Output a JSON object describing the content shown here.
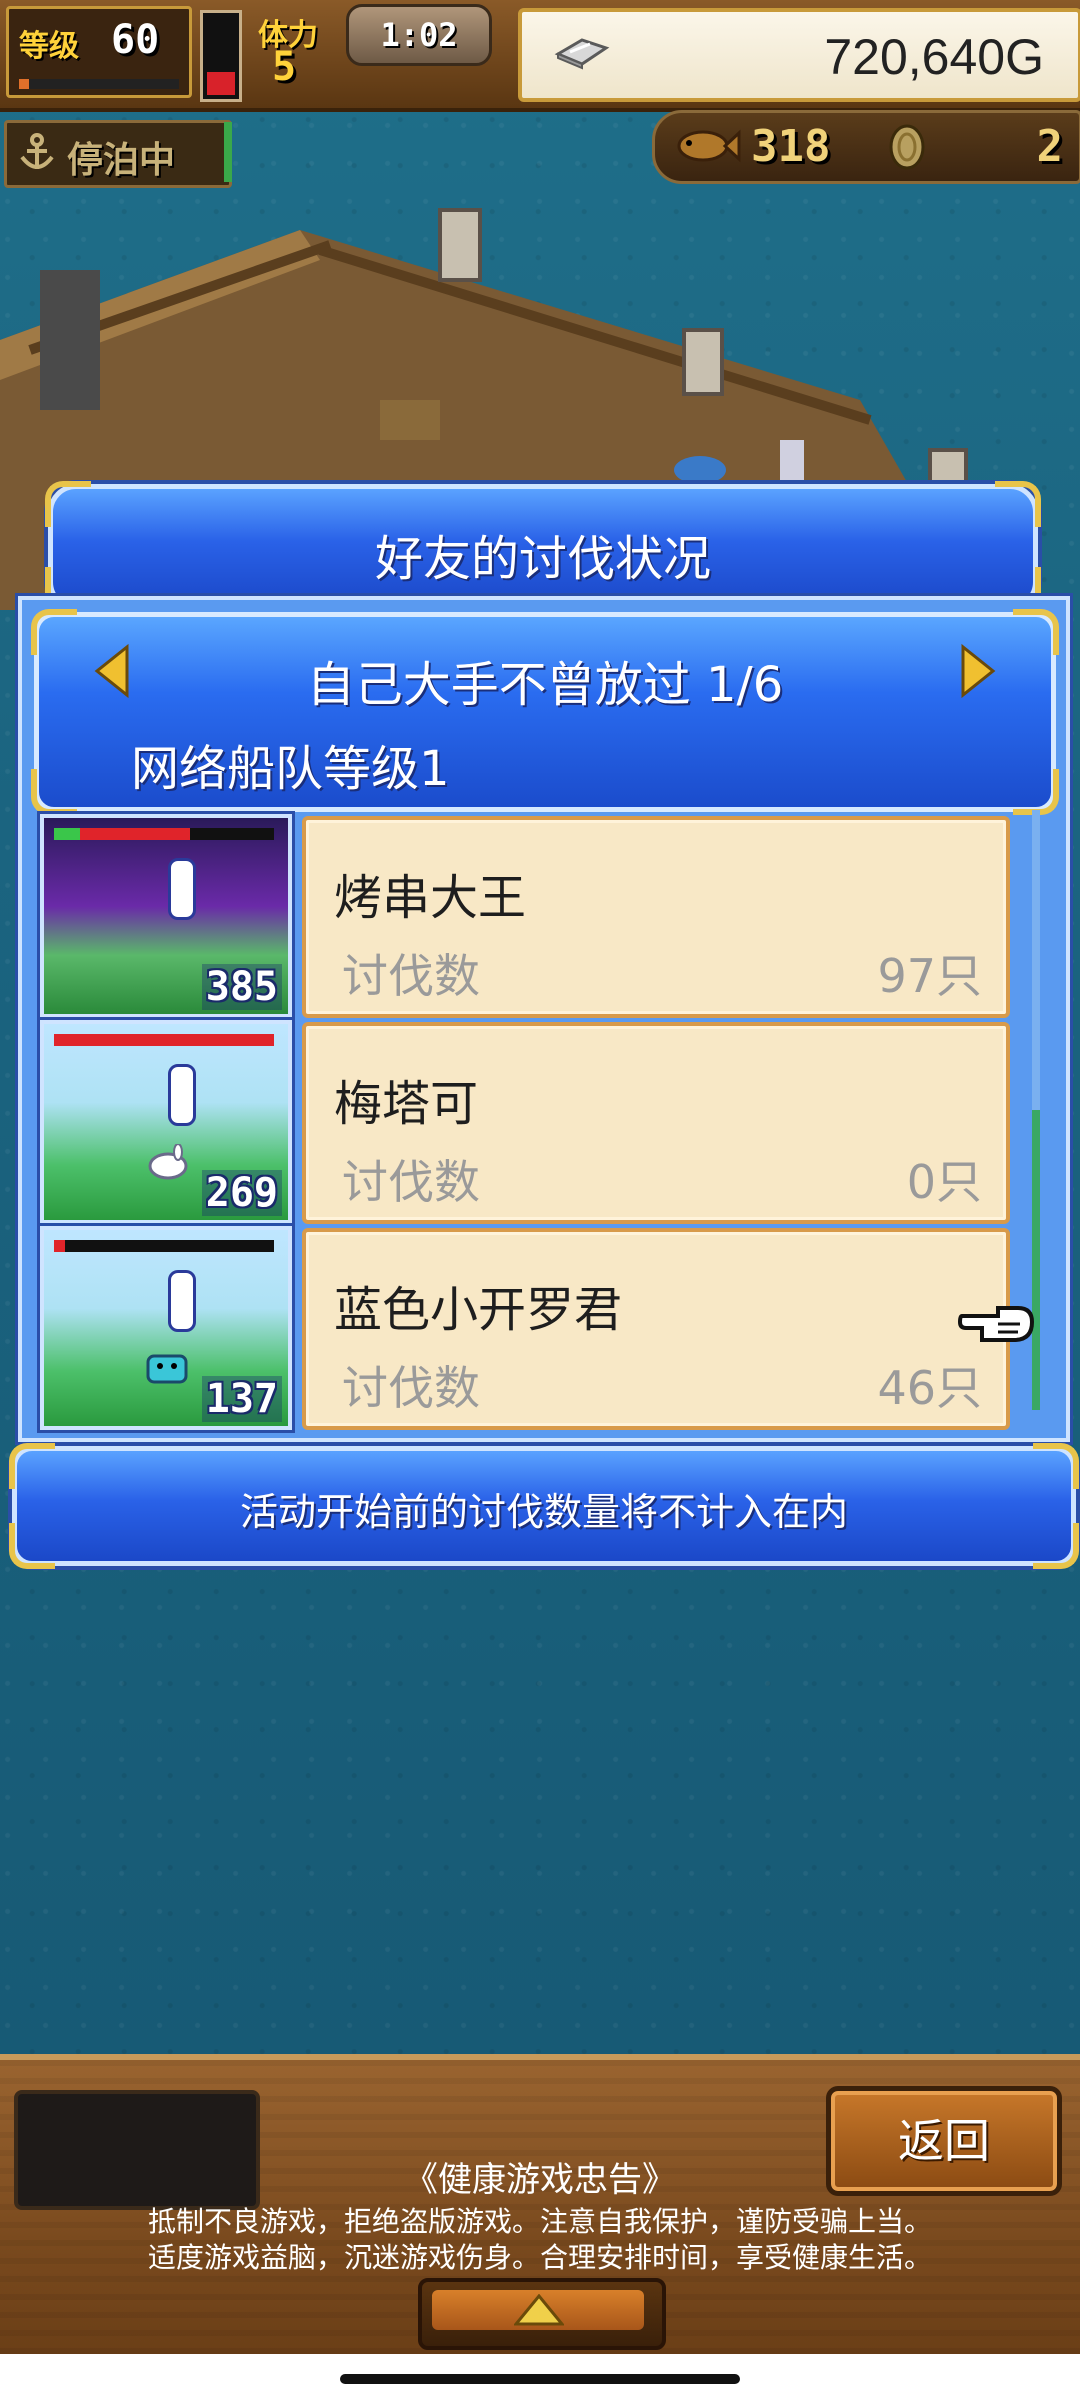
{
  "hud": {
    "level_label": "等级",
    "level_value": "60",
    "exp_fraction": 0.06,
    "stamina_fraction": 0.3,
    "stamina_label": "体力",
    "stamina_value": "5",
    "timer": "1:02",
    "gold_icon": "silver-bar-icon",
    "gold_value": "720,640G",
    "status": "停泊中",
    "status_icon": "anchor-icon",
    "resource1_icon": "fish-icon",
    "resource1_value": "318",
    "resource2_icon": "coin-icon",
    "resource2_value": "2"
  },
  "dialog": {
    "title": "好友的讨伐状况",
    "fleet_title": "自己大手不曾放过 1/6",
    "fleet_level": "网络船队等级1",
    "count_label": "讨伐数",
    "entries": [
      {
        "name": "烤串大王",
        "count": "97只",
        "power": "385",
        "hp_fraction": 0.62,
        "hp_green_fraction": 0.12
      },
      {
        "name": "梅塔可",
        "count": "0只",
        "power": "269",
        "hp_fraction": 1.0,
        "hp_green_fraction": 0.0
      },
      {
        "name": "蓝色小开罗君",
        "count": "46只",
        "power": "137",
        "hp_fraction": 0.05,
        "hp_green_fraction": 0.0
      }
    ],
    "notice": "活动开始前的讨伐数量将不计入在内"
  },
  "bottom": {
    "back_label": "返回",
    "health_title": "《健康游戏忠告》",
    "health_line1": "抵制不良游戏，拒绝盗版游戏。注意自我保护，谨防受骗上当。",
    "health_line2": "适度游戏益脑，沉迷游戏伤身。合理安排时间，享受健康生活。"
  },
  "colors": {
    "panel_blue": "#2a62e8",
    "card_bg": "#f8e8c6",
    "gold_accent": "#e8c44a"
  }
}
